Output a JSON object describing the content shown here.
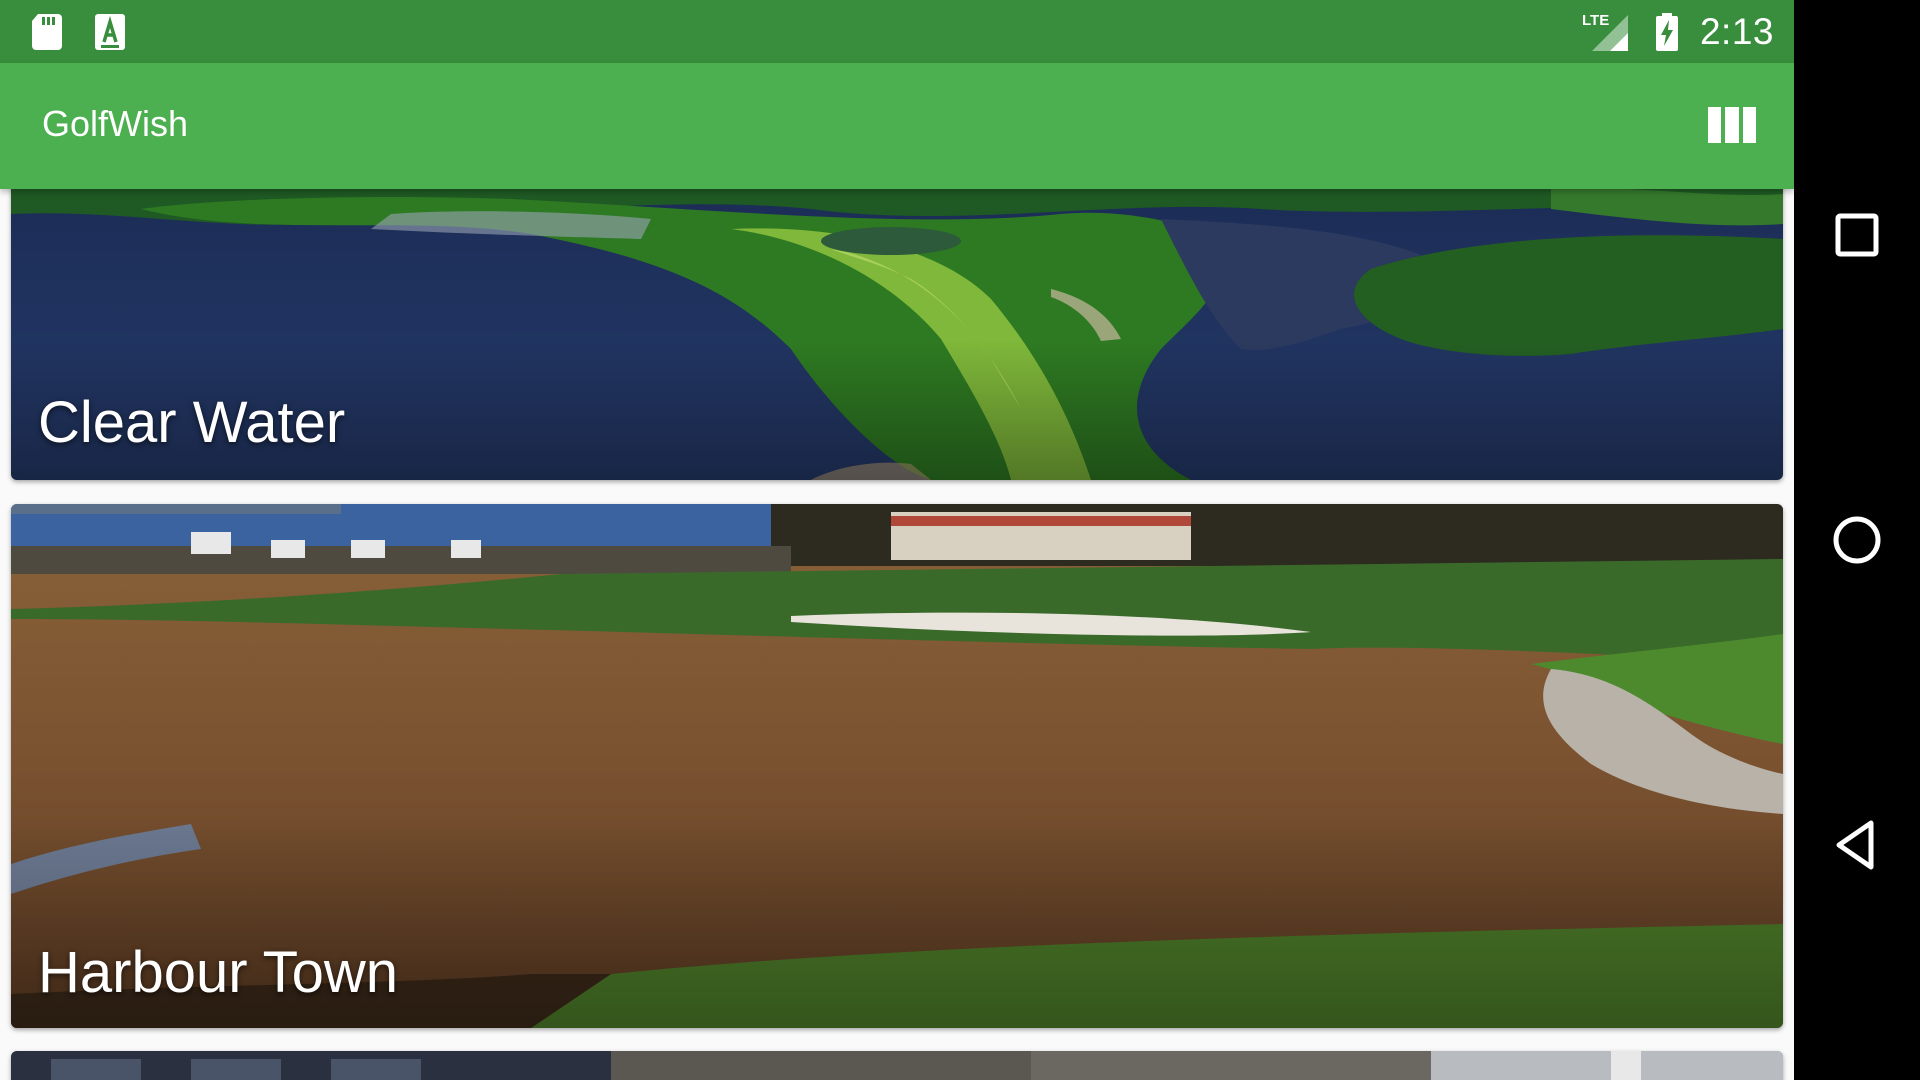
{
  "status_bar": {
    "time": "2:13",
    "network": "LTE",
    "icons": [
      "sd-card-icon",
      "text-a-icon",
      "signal-lte-icon",
      "battery-charging-icon"
    ]
  },
  "app_bar": {
    "title": "GolfWish",
    "action_icon": "view-column-icon"
  },
  "courses": [
    {
      "name": "Clear Water"
    },
    {
      "name": "Harbour Town"
    },
    {
      "name": ""
    }
  ],
  "nav_bar": {
    "icons": [
      "recents-icon",
      "home-icon",
      "back-icon"
    ]
  },
  "colors": {
    "status_bar": "#388e3c",
    "app_bar": "#4caf50",
    "text_on_primary": "#ffffff"
  }
}
